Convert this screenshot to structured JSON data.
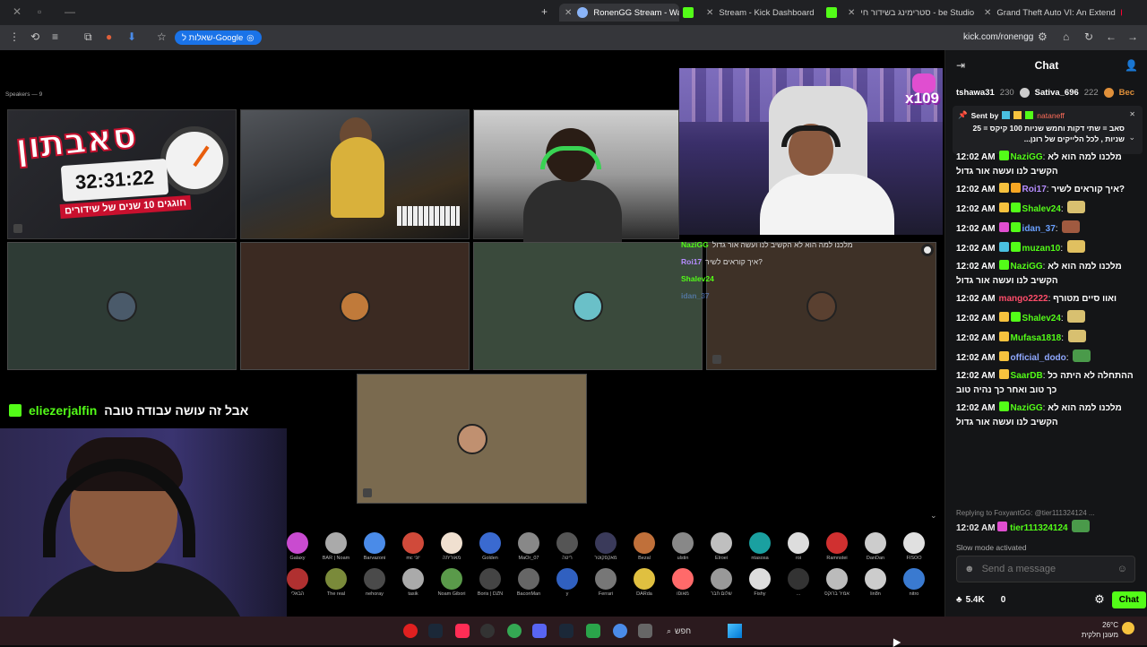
{
  "browser": {
    "tabs": [
      {
        "title": "RonenGG Stream - Watch L",
        "favicon": "kick-icon",
        "active": true
      },
      {
        "title": "Stream - Kick Dashboard",
        "favicon": "kick-icon",
        "active": false
      },
      {
        "title": "סטרימינג בשידור חי - be Studio",
        "favicon": "youtube-icon",
        "active": false
      },
      {
        "title": "Grand Theft Auto VI: An Extend",
        "favicon": "youtube-icon",
        "active": false
      }
    ],
    "new_tab": "+",
    "extension_label": "שאלות ל-Google",
    "url": "kick.com/ronengg"
  },
  "stream": {
    "speakers_label": "Speakers — 9",
    "logo": {
      "word": "סאבתון",
      "timer": "32:31:22",
      "subtitle": "חוגגים 10 שנים של שידורים"
    },
    "multiplier": "x109",
    "overlay_chat": [
      {
        "user": "NaziGG",
        "text": "מלכנו למה הוא לא הקשיב לנו ועשה אור גדול",
        "color": "#53fc18"
      },
      {
        "user": "Roi17",
        "text": "איך קוראים לשיר?",
        "color": "#b58cff"
      },
      {
        "user": "Shalev24",
        "text": "",
        "color": "#53fc18"
      },
      {
        "user": "idan_37",
        "text": "",
        "color": "#6aa0ff"
      }
    ],
    "alert": {
      "user": "eliezerjalfin",
      "message": "אבל זה עושה עבודה טובה"
    },
    "strip_row1": [
      "Galaxy",
      "BAR | Noam",
      "Barvazoni",
      "mc יוני",
      "מאוריתה",
      "Golden",
      "MaOr_07",
      "ריטה",
      "מאקסקוטר",
      "Bezal",
      "ulstin",
      "Elroei",
      "ntasosa",
      "roi",
      "Ramnstei",
      "DanDan",
      "FISOO"
    ],
    "strip_row2": [
      "הבאלי",
      "The real",
      "nehoray",
      "tasik",
      "Noam Gibori",
      "Boris | DZN",
      "BaconMan",
      "y",
      "Ferrari",
      "DARda",
      "מאוסו",
      "שלום חבר",
      "Fishy",
      "...",
      "אמיר ברוקס",
      "lin8n",
      "nitro"
    ],
    "strip_colors": [
      "#c94bd0",
      "#aaaaaa",
      "#4a8be8",
      "#d04a3a",
      "#f0e0d0",
      "#3a6ad0",
      "#888888",
      "#555555",
      "#3a3a5a",
      "#c0703a",
      "#888888",
      "#bfbfbf",
      "#1aa0a0",
      "#dddddd",
      "#d03030",
      "#cccccc",
      "#e0e0e0"
    ],
    "strip_colors2": [
      "#b03030",
      "#7a8a3a",
      "#4a4a4a",
      "#aaaaaa",
      "#5a9a4a",
      "#444444",
      "#666666",
      "#3060c0",
      "#777777",
      "#e0c040",
      "#ff6a6a",
      "#999999",
      "#dddddd",
      "#333333",
      "#bbbbbb",
      "#cccccc",
      "#3a7ad0"
    ]
  },
  "chat": {
    "title": "Chat",
    "gifters": [
      {
        "name": "tshawa31",
        "count": "230"
      },
      {
        "name": "Sativa_696",
        "count": "222"
      },
      {
        "name": "Bec",
        "count": ""
      }
    ],
    "pinned": {
      "sent_by_label": "Sent by",
      "user": "nataneff",
      "text": "סאב = שתי דקות וחמש שניות 100 קיקס = 25 שניות , לכל הלייקים של רונן..."
    },
    "messages": [
      {
        "time": "12:02 AM",
        "user": "NaziGG",
        "color": "#53fc18",
        "badges": [
          "#53fc18"
        ],
        "text": "מלכנו למה הוא לא הקשיב לנו ועשה אור גדול"
      },
      {
        "time": "12:02 AM",
        "user": "Roi17",
        "color": "#b58cff",
        "badges": [
          "#f6c23e",
          "#f6a623"
        ],
        "text": "איך קוראים לשיר?"
      },
      {
        "time": "12:02 AM",
        "user": "Shalev24",
        "color": "#53fc18",
        "badges": [
          "#f6c23e",
          "#53fc18"
        ],
        "text": "",
        "emote": "#d8c070"
      },
      {
        "time": "12:02 AM",
        "user": "idan_37",
        "color": "#6aa0ff",
        "badges": [
          "#e04ed0",
          "#53fc18"
        ],
        "text": "",
        "emote": "#a05a40"
      },
      {
        "time": "12:02 AM",
        "user": "muzan10",
        "color": "#53fc18",
        "badges": [
          "#4ac0e0",
          "#53fc18"
        ],
        "text": "",
        "emote": "#e0c060"
      },
      {
        "time": "12:02 AM",
        "user": "NaziGG",
        "color": "#53fc18",
        "badges": [
          "#53fc18"
        ],
        "text": "מלכנו למה הוא לא הקשיב לנו ועשה אור גדול"
      },
      {
        "time": "",
        "user": "",
        "color": "#fff",
        "badges": [],
        "text": ""
      },
      {
        "time": "12:02 AM",
        "user": "Shalev24",
        "color": "#53fc18",
        "badges": [
          "#f6c23e",
          "#53fc18"
        ],
        "text": "",
        "emote": "#d8c070"
      },
      {
        "time": "12:02 AM",
        "user": "Mufasa1818",
        "color": "#53fc18",
        "badges": [
          "#f6c23e"
        ],
        "text": "",
        "emote": "#d8c070"
      },
      {
        "time": "12:02 AM",
        "user": "official_dodo",
        "color": "#8fa8ff",
        "badges": [
          "#f6c23e"
        ],
        "text": "",
        "emote": "#4a9a4a"
      },
      {
        "time": "12:02 AM",
        "user": "SaarDB",
        "color": "#53fc18",
        "badges": [
          "#f6c23e"
        ],
        "text": "ההתחלה לא היתה כל כך טוב ואחר כך נהיה טוב"
      },
      {
        "time": "12:02 AM",
        "user": "NaziGG",
        "color": "#53fc18",
        "badges": [
          "#53fc18"
        ],
        "text": "מלכנו למה הוא לא הקשיב לנו ועשה אור גדול"
      }
    ],
    "mango_msg": {
      "time": "12:02 AM",
      "user": "mango2222",
      "color": "#ff4d6a",
      "text": "ואוו סיים מטורף"
    },
    "reply": {
      "context": "Replying to FoxyantGG: @tier111324124 ...",
      "time": "12:02 AM",
      "user": "tier111324124"
    },
    "slow_mode": "Slow mode activated",
    "input_placeholder": "Send a message",
    "kicks": "5.4K",
    "viewers_zero": "0",
    "send_label": "Chat"
  },
  "taskbar": {
    "search_label": "חפש",
    "weather_temp": "26°C",
    "weather_desc": "מעונן חלקית"
  },
  "colors": {
    "kick_green": "#53fc18",
    "chat_bg": "#141517"
  }
}
